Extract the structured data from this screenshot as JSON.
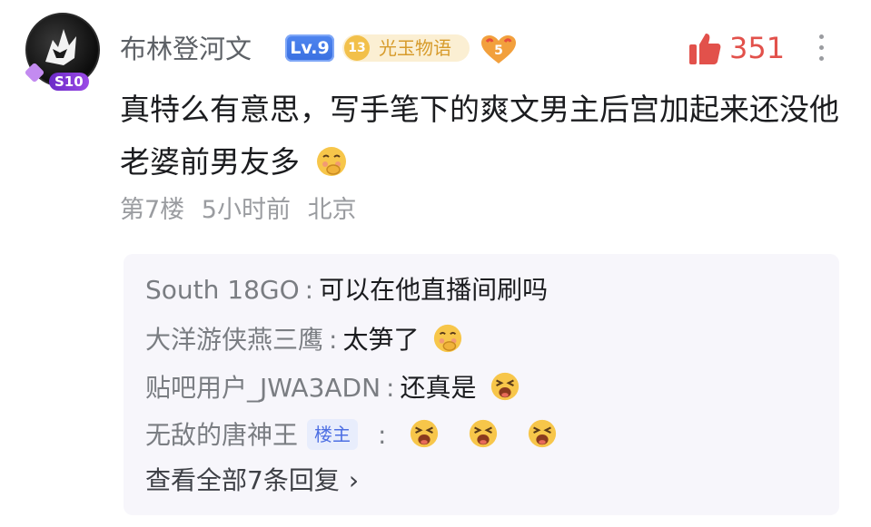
{
  "post": {
    "author": "布林登河文",
    "level_badge": "Lv.9",
    "fan_badge": {
      "level": "13",
      "name": "光玉物语"
    },
    "heart_badge_level": "5",
    "avatar_badge": "S10",
    "likes": "351",
    "text": "真特么有意思，写手笔下的爽文男主后宫加起来还没他老婆前男友多",
    "meta": {
      "floor": "第7楼",
      "time": "5小时前",
      "location": "北京"
    }
  },
  "replies": [
    {
      "author": "South 18GO",
      "separator": ":",
      "text": "可以在他直播间刷吗",
      "emoji": []
    },
    {
      "author": "大洋游侠燕三鹰",
      "separator": ":",
      "text": "太笋了",
      "emoji": [
        "shy-emoji"
      ]
    },
    {
      "author": "贴吧用户_JWA3ADN",
      "separator": ":",
      "text": "还真是",
      "emoji": [
        "laugh-emoji"
      ]
    },
    {
      "author": "无敌的唐神王",
      "tag": "楼主",
      "separator": ":",
      "text": "",
      "emoji": [
        "laugh-emoji",
        "laugh-emoji",
        "laugh-emoji"
      ]
    }
  ],
  "view_all": "查看全部7条回复",
  "colors": {
    "like_red": "#e2514b",
    "owner_tag_blue": "#4d6fe3",
    "level_blue": "#3a6fe0",
    "fan_gold": "#d79b2b"
  }
}
